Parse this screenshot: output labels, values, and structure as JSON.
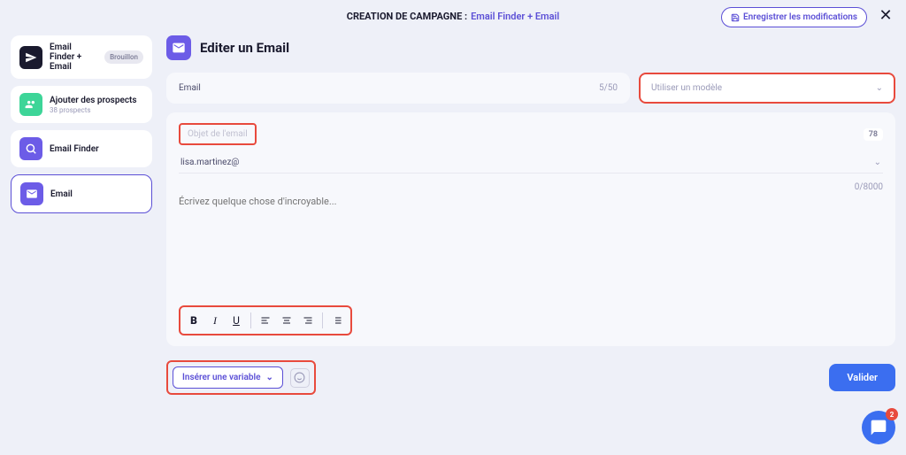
{
  "topbar": {
    "title": "CREATION DE CAMPAGNE :",
    "link": "Email Finder + Email",
    "save_label": "Enregistrer les modifications"
  },
  "sidebar": {
    "items": [
      {
        "label": "Email Finder + Email",
        "badge": "Brouillon"
      },
      {
        "label": "Ajouter des prospects",
        "subtitle": "38 prospects"
      },
      {
        "label": "Email Finder"
      },
      {
        "label": "Email"
      }
    ]
  },
  "header": {
    "title": "Editer un Email"
  },
  "row1": {
    "label": "Email",
    "count": "5/50",
    "template_placeholder": "Utiliser un modèle"
  },
  "editor": {
    "subject_placeholder": "Objet de l'email",
    "subject_count": "78",
    "sender": "lisa.martinez@",
    "body_placeholder": "Écrivez quelque chose d'incroyable...",
    "body_count": "0/8000"
  },
  "bottom": {
    "variable_label": "Insérer une variable",
    "validate_label": "Valider"
  },
  "chat": {
    "badge": "2"
  }
}
